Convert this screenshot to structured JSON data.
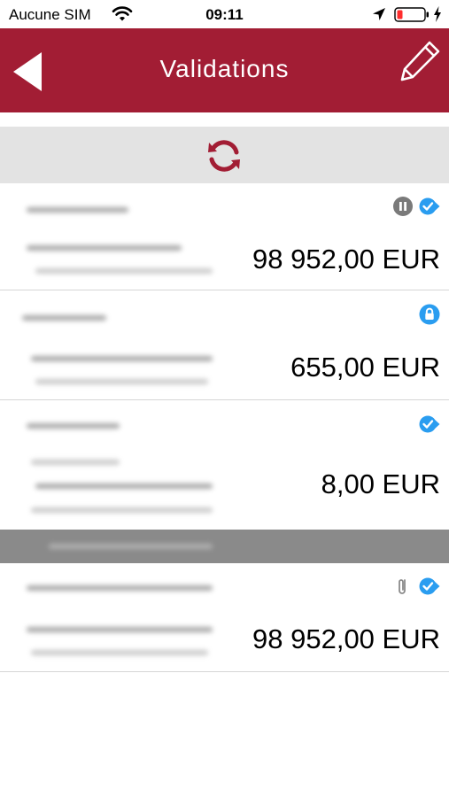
{
  "status_bar": {
    "carrier": "Aucune SIM",
    "time": "09:11",
    "icons": [
      "wifi-icon",
      "location-arrow-icon",
      "battery-low-icon",
      "charging-bolt-icon"
    ]
  },
  "nav": {
    "title": "Validations",
    "back_icon": "back-triangle-icon",
    "edit_icon": "pencil-icon",
    "bar_color": "#a21d34"
  },
  "refresh": {
    "icon": "refresh-icon",
    "color": "#a21d34"
  },
  "items": [
    {
      "amount": "98 952,00 EUR",
      "status_icons": [
        "pause-icon",
        "forward-check-icon"
      ]
    },
    {
      "amount": "655,00 EUR",
      "status_icons": [
        "lock-icon"
      ]
    },
    {
      "amount": "8,00 EUR",
      "status_icons": [
        "forward-check-icon"
      ]
    },
    {
      "amount": "98 952,00 EUR",
      "status_icons": [
        "attachment-icon",
        "forward-check-icon"
      ]
    }
  ],
  "colors": {
    "accent_blue": "#2a9df0",
    "pause_grey": "#7a7a7a"
  }
}
